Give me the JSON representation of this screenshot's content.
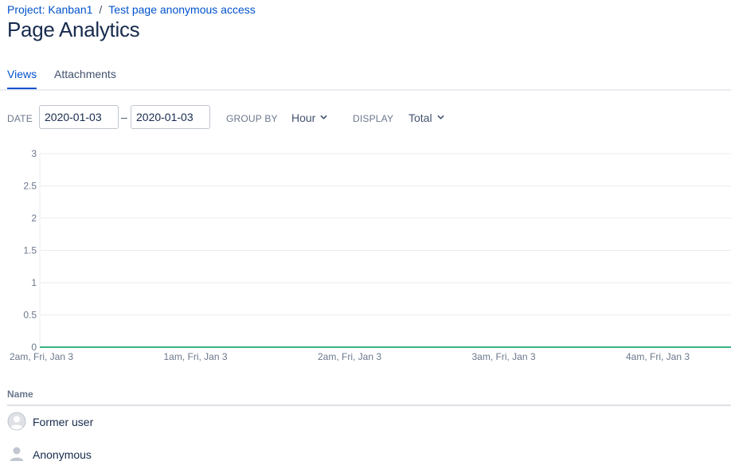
{
  "breadcrumb": {
    "project": "Project: Kanban1",
    "separator": "/",
    "page": "Test page anonymous access"
  },
  "page_title": "Page Analytics",
  "tabs": [
    {
      "label": "Views",
      "active": true
    },
    {
      "label": "Attachments",
      "active": false
    }
  ],
  "filters": {
    "date_label": "DATE",
    "date_from": "2020-01-03",
    "date_dash": "–",
    "date_to": "2020-01-03",
    "group_by_label": "GROUP BY",
    "group_by_value": "Hour",
    "display_label": "DISPLAY",
    "display_value": "Total"
  },
  "chart_data": {
    "type": "line",
    "x": [
      "2am, Fri, Jan 3",
      "1am, Fri, Jan 3",
      "2am, Fri, Jan 3",
      "3am, Fri, Jan 3",
      "4am, Fri, Jan 3"
    ],
    "series": [
      {
        "values": [
          0,
          0,
          0,
          0,
          0
        ]
      }
    ],
    "y_ticks": [
      "0",
      "0.5",
      "1",
      "1.5",
      "2",
      "2.5",
      "3"
    ],
    "ylim": [
      0,
      3
    ],
    "grid": true,
    "line_color": "#36b37e",
    "grid_color": "#ebecf0"
  },
  "table": {
    "header": "Name",
    "rows": [
      {
        "name": "Former user",
        "icon": "user-avatar-circle-icon"
      },
      {
        "name": "Anonymous",
        "icon": "anonymous-user-icon"
      }
    ]
  },
  "colors": {
    "link": "#0052cc",
    "text": "#172b4d",
    "muted": "#6b778c"
  }
}
